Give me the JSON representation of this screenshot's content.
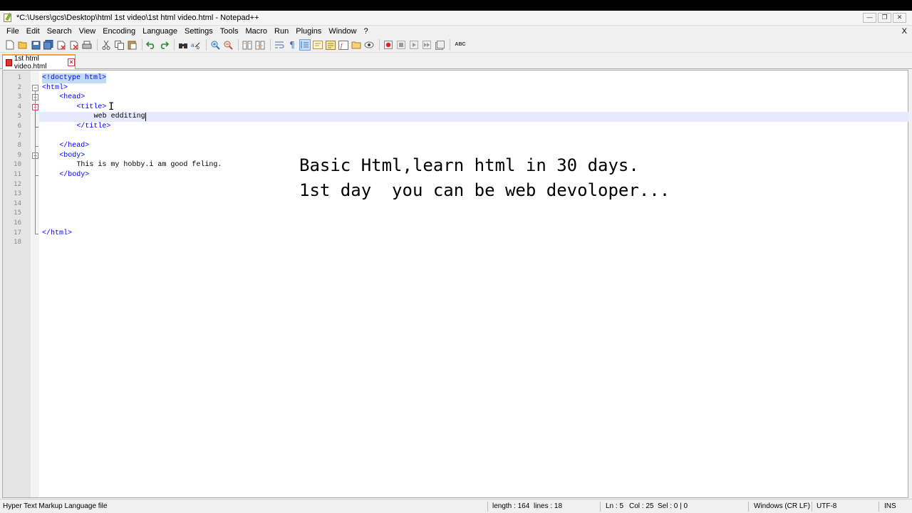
{
  "window": {
    "title": "*C:\\Users\\gcs\\Desktop\\html 1st video\\1st html video.html - Notepad++"
  },
  "menu": [
    "File",
    "Edit",
    "Search",
    "View",
    "Encoding",
    "Language",
    "Settings",
    "Tools",
    "Macro",
    "Run",
    "Plugins",
    "Window",
    "?"
  ],
  "menu_close": "X",
  "toolbar": {
    "icons": [
      "new-file-icon",
      "open-file-icon",
      "save-icon",
      "save-all-icon",
      "close-icon",
      "close-all-icon",
      "print-icon",
      "cut-icon",
      "copy-icon",
      "paste-icon",
      "undo-icon",
      "redo-icon",
      "find-icon",
      "replace-icon",
      "zoom-in-icon",
      "zoom-out-icon",
      "sync-vertical-icon",
      "sync-horizontal-icon",
      "word-wrap-icon",
      "show-all-characters-icon",
      "indent-guide-icon",
      "user-language-icon",
      "document-map-icon",
      "function-list-icon",
      "folder-as-workspace-icon",
      "monitoring-icon",
      "record-macro-icon",
      "stop-recording-icon",
      "playback-macro-icon",
      "run-macro-multiple-icon",
      "save-macro-icon",
      "spell-check-icon"
    ],
    "spell_check_label": "ABC"
  },
  "tabs": [
    {
      "label": "1st html video.html",
      "modified": true
    }
  ],
  "editor": {
    "lines": [
      {
        "n": "1",
        "indent": 0,
        "text": "<!doctype html>"
      },
      {
        "n": "2",
        "indent": 0,
        "text": "<html>"
      },
      {
        "n": "3",
        "indent": 4,
        "text": "<head>"
      },
      {
        "n": "4",
        "indent": 8,
        "text": "<title>"
      },
      {
        "n": "5",
        "indent": 12,
        "text": "web edditing"
      },
      {
        "n": "6",
        "indent": 8,
        "text": "</title>"
      },
      {
        "n": "7",
        "indent": 0,
        "text": ""
      },
      {
        "n": "8",
        "indent": 4,
        "text": "</head>"
      },
      {
        "n": "9",
        "indent": 4,
        "text": "<body>"
      },
      {
        "n": "10",
        "indent": 8,
        "text": "This is my hobby.i am good feling."
      },
      {
        "n": "11",
        "indent": 4,
        "text": "</body>"
      },
      {
        "n": "12",
        "indent": 0,
        "text": ""
      },
      {
        "n": "13",
        "indent": 0,
        "text": ""
      },
      {
        "n": "14",
        "indent": 0,
        "text": ""
      },
      {
        "n": "15",
        "indent": 0,
        "text": ""
      },
      {
        "n": "16",
        "indent": 0,
        "text": ""
      },
      {
        "n": "17",
        "indent": 0,
        "text": "</html>"
      },
      {
        "n": "18",
        "indent": 0,
        "text": ""
      }
    ],
    "current_line": 5
  },
  "overlay": {
    "line1": "Basic Html,learn html in 30 days.",
    "line2": "1st day  you can be web devoloper..."
  },
  "status": {
    "file_type": "Hyper Text Markup Language file",
    "length": "length : 164",
    "lines": "lines : 18",
    "ln": "Ln : 5",
    "col": "Col : 25",
    "sel": "Sel : 0 | 0",
    "eol": "Windows (CR LF)",
    "encoding": "UTF-8",
    "mode": "INS"
  },
  "colors": {
    "tag": "#0000ff",
    "tab_accent": "#f3a23a",
    "current_line": "#e8e8ff",
    "fold_active": "#d44444"
  }
}
